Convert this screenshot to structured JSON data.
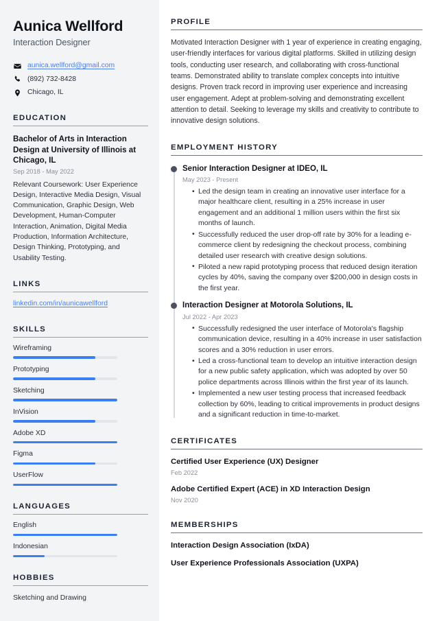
{
  "sidebar": {
    "name": "Aunica Wellford",
    "job_title": "Interaction Designer",
    "contact": {
      "email": "aunica.wellford@gmail.com",
      "phone": "(892) 732-8428",
      "location": "Chicago, IL",
      "email_icon": "envelope-icon",
      "phone_icon": "phone-icon",
      "location_icon": "map-pin-icon"
    },
    "education": {
      "heading": "EDUCATION",
      "degree": "Bachelor of Arts in Interaction Design at University of Illinois at Chicago, IL",
      "date": "Sep 2018 - May 2022",
      "description": "Relevant Coursework: User Experience Design, Interactive Media Design, Visual Communication, Graphic Design, Web Development, Human-Computer Interaction, Animation, Digital Media Production, Information Architecture, Design Thinking, Prototyping, and Usability Testing."
    },
    "links": {
      "heading": "LINKS",
      "items": [
        {
          "label": "linkedin.com/in/aunicawellford"
        }
      ]
    },
    "skills": {
      "heading": "SKILLS",
      "items": [
        {
          "label": "Wireframing",
          "level": 79
        },
        {
          "label": "Prototyping",
          "level": 79
        },
        {
          "label": "Sketching",
          "level": 100
        },
        {
          "label": "InVision",
          "level": 79
        },
        {
          "label": "Adobe XD",
          "level": 100
        },
        {
          "label": "Figma",
          "level": 79
        },
        {
          "label": "UserFlow",
          "level": 100
        }
      ]
    },
    "languages": {
      "heading": "LANGUAGES",
      "items": [
        {
          "label": "English",
          "level": 100
        },
        {
          "label": "Indonesian",
          "level": 30
        }
      ]
    },
    "hobbies": {
      "heading": "HOBBIES",
      "items": [
        {
          "label": "Sketching and Drawing"
        }
      ]
    }
  },
  "main": {
    "profile": {
      "heading": "PROFILE",
      "text": "Motivated Interaction Designer with 1 year of experience in creating engaging, user-friendly interfaces for various digital platforms. Skilled in utilizing design tools, conducting user research, and collaborating with cross-functional teams. Demonstrated ability to translate complex concepts into intuitive designs. Proven track record in improving user experience and increasing user engagement. Adept at problem-solving and demonstrating excellent attention to detail. Seeking to leverage my skills and creativity to contribute to innovative design solutions."
    },
    "employment": {
      "heading": "EMPLOYMENT HISTORY",
      "jobs": [
        {
          "title": "Senior Interaction Designer at IDEO, IL",
          "date": "May 2023 - Present",
          "points": [
            "Led the design team in creating an innovative user interface for a major healthcare client, resulting in a 25% increase in user engagement and an additional 1 million users within the first six months of launch.",
            "Successfully reduced the user drop-off rate by 30% for a leading e-commerce client by redesigning the checkout process, combining detailed user research with creative design solutions.",
            "Piloted a new rapid prototyping process that reduced design iteration cycles by 40%, saving the company over $200,000 in design costs in the first year."
          ]
        },
        {
          "title": "Interaction Designer at Motorola Solutions, IL",
          "date": "Jul 2022 - Apr 2023",
          "points": [
            "Successfully redesigned the user interface of Motorola's flagship communication device, resulting in a 40% increase in user satisfaction scores and a 30% reduction in user errors.",
            "Led a cross-functional team to develop an intuitive interaction design for a new public safety application, which was adopted by over 50 police departments across Illinois within the first year of its launch.",
            "Implemented a new user testing process that increased feedback collection by 60%, leading to critical improvements in product designs and a significant reduction in time-to-market."
          ]
        }
      ]
    },
    "certificates": {
      "heading": "CERTIFICATES",
      "items": [
        {
          "title": "Certified User Experience (UX) Designer\u0001",
          "date": "Feb 2022"
        },
        {
          "title": "Adobe Certified Expert (ACE) in XD Interaction Design",
          "date": "Nov 2020"
        }
      ]
    },
    "memberships": {
      "heading": "MEMBERSHIPS",
      "items": [
        {
          "title": "Interaction Design Association (IxDA)"
        },
        {
          "title": "User Experience Professionals Association (UXPA)"
        }
      ]
    }
  },
  "colors": {
    "accent": "#3b7ef2",
    "link": "#4a7ef0",
    "sidebar_bg": "#f2f4f6",
    "heading": "#1d2330",
    "body_text": "#2c3038",
    "muted_text": "#8a8f98",
    "timeline_dot": "#4b5160"
  }
}
